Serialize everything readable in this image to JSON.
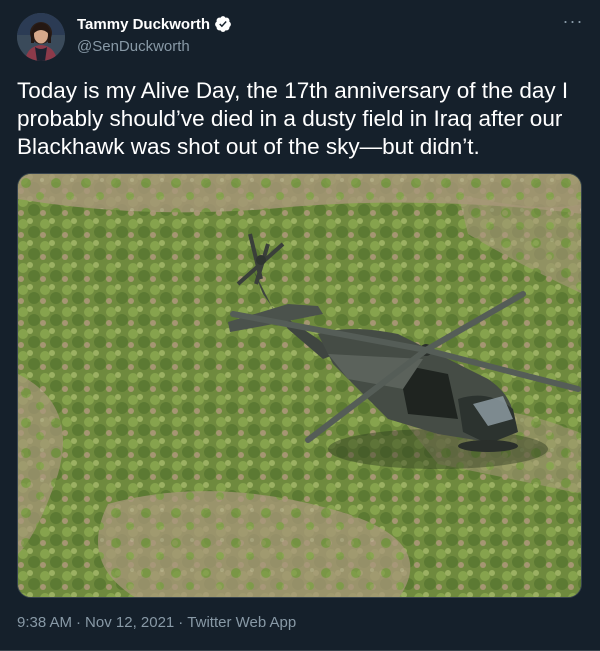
{
  "author": {
    "display_name": "Tammy Duckworth",
    "handle": "@SenDuckworth",
    "verified": true,
    "avatar_icon": "profile-photo"
  },
  "more_menu": {
    "label": "···",
    "icon": "more-horizontal-icon"
  },
  "tweet": {
    "text": "Today is my Alive Day, the 17th anniversary of the day I\nprobably should’ve died in a dusty field in Iraq after our\nBlackhawk was shot out of the sky—but didn’t."
  },
  "media": {
    "type": "photo",
    "subject": "helicopter-in-grass-field"
  },
  "meta": {
    "time": "9:38 AM",
    "sep1": "·",
    "date": "Nov 12, 2021",
    "sep2": "·",
    "source": "Twitter Web App"
  },
  "colors": {
    "background": "#15202b",
    "text": "#ffffff",
    "secondary": "#8899a6",
    "verified": "#1d9bf0",
    "border": "#38444d"
  }
}
